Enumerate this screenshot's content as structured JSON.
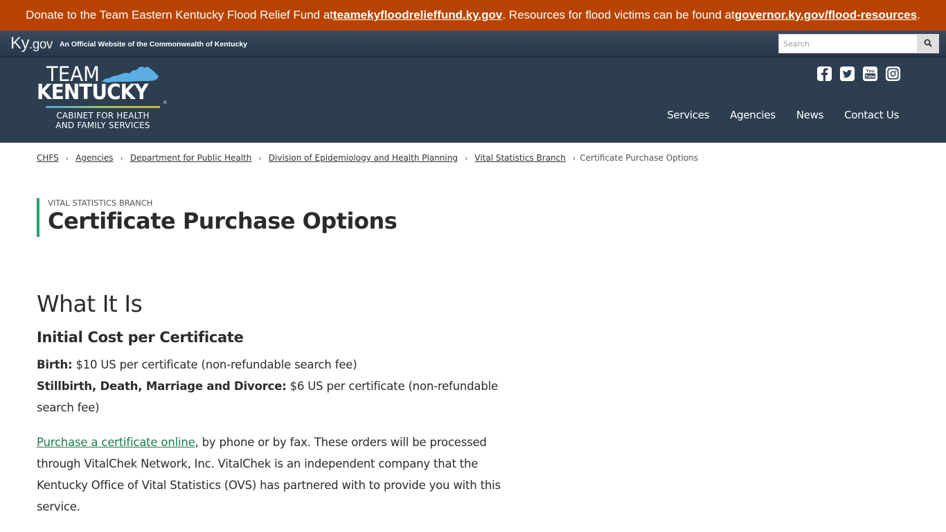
{
  "alert": {
    "text_before": "Donate to the Team Eastern Kentucky Flood Relief Fund at ",
    "link1": "teamekyfloodrelieffund.ky.gov",
    "text_middle": ". Resources for flood victims can be found at ",
    "link2": "governor.ky.gov/flood-resources",
    "text_after": "."
  },
  "kygov": {
    "logo_ky": "Ky",
    "logo_gov": ".gov",
    "tagline": "An Official Website of the Commonwealth of Kentucky",
    "search_placeholder": "Search",
    "search_icon": "search-icon"
  },
  "header": {
    "logo": {
      "team": "TEAM",
      "kentucky": "KENTUCKY",
      "reg": "®",
      "cabinet_line1": "CABINET FOR HEALTH",
      "cabinet_line2": "AND FAMILY SERVICES"
    },
    "social": [
      "facebook-icon",
      "twitter-icon",
      "youtube-icon",
      "instagram-icon"
    ],
    "nav": [
      {
        "label": "Services"
      },
      {
        "label": "Agencies"
      },
      {
        "label": "News"
      },
      {
        "label": "Contact Us"
      }
    ]
  },
  "breadcrumb": {
    "items": [
      {
        "label": "CHFS"
      },
      {
        "label": "Agencies"
      },
      {
        "label": "Department for Public Health"
      },
      {
        "label": "Division of Epidemiology and Health Planning"
      },
      {
        "label": "Vital Statistics Branch"
      }
    ],
    "current": "Certificate Purchase Options",
    "separator": "›"
  },
  "page": {
    "eyebrow": "VITAL STATISTICS BRANCH",
    "title": "Certificate Purchase Options"
  },
  "content": {
    "h2": "What It Is",
    "h3": "Initial Cost per Certificate",
    "birth_label": "Birth:",
    "birth_text": " $10 US per certificate (non-refundable search fee)",
    "other_label": "Stillbirth, Death, Marriage and Divorce:",
    "other_text": " $6 US per certificate (non-refundable search fee)",
    "purchase_link": "Purchase a certificate online",
    "purchase_text": ", by phone or by fax. These orders will be processed through VitalChek Network, Inc. VitalChek is an independent company that the Kentucky Office of Vital Statistics (OVS) has partnered with to provide you with this service."
  },
  "colors": {
    "alert_bg": "#b84300",
    "header_bg": "#2d3e50",
    "accent_green": "#25a472",
    "link_green": "#1e7a4e",
    "state_blue": "#5aaee4"
  }
}
